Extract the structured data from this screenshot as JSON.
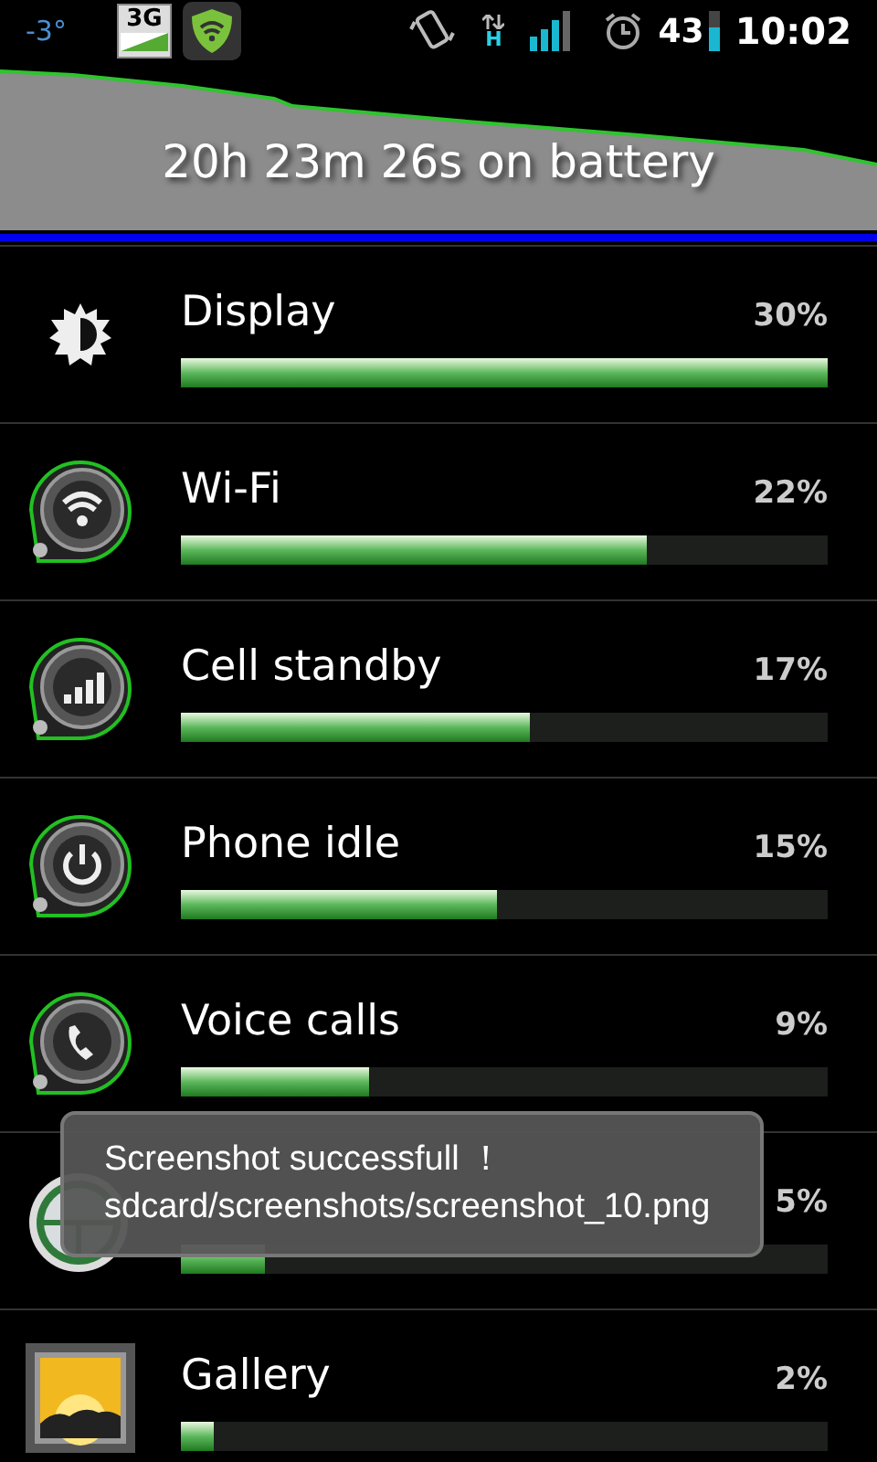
{
  "status_bar": {
    "temperature": "-3°",
    "network_badge": "3G",
    "data_indicator": "H",
    "battery_percent": "43",
    "time": "10:02"
  },
  "battery_graph": {
    "caption": "20h 23m 26s on battery"
  },
  "usage": [
    {
      "kind": "display",
      "name": "Display",
      "percent": "30%",
      "level": 1.0
    },
    {
      "kind": "wifi",
      "name": "Wi-Fi",
      "percent": "22%",
      "level": 0.72
    },
    {
      "kind": "cell",
      "name": "Cell standby",
      "percent": "17%",
      "level": 0.54
    },
    {
      "kind": "idle",
      "name": "Phone idle",
      "percent": "15%",
      "level": 0.49
    },
    {
      "kind": "voice",
      "name": "Voice calls",
      "percent": "9%",
      "level": 0.29
    },
    {
      "kind": "app",
      "percent": "5%",
      "level": 0.13
    },
    {
      "kind": "gallery",
      "name": "Gallery",
      "percent": "2%",
      "level": 0.05
    }
  ],
  "toast": {
    "lines": [
      "Screenshot successfull ！",
      "sdcard/screenshots/screenshot_10.png"
    ]
  }
}
